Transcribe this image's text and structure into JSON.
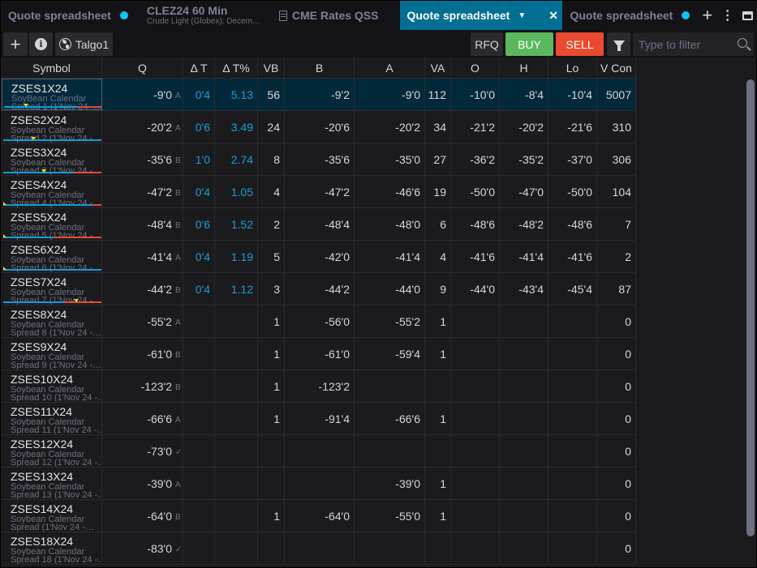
{
  "tabs": [
    {
      "label": "Quote spreadsheet",
      "dot": true,
      "active": false
    },
    {
      "label": "CLEZ24 60 Min",
      "sublabel": "Crude Light (Globex): Decem…",
      "active": false
    },
    {
      "label": "CME Rates QSS",
      "icon": "book-icon",
      "active": false
    },
    {
      "label": "Quote spreadsheet",
      "dot": true,
      "active": true
    },
    {
      "label": "Quote spreadsheet",
      "dot": true,
      "active": false
    }
  ],
  "tabbar_icons": [
    "plus-icon",
    "more-vertical-icon",
    "maximize-icon"
  ],
  "toolbar": {
    "add_label": "+",
    "info_icon": "i",
    "account_label": "Talgo1",
    "rfq_label": "RFQ",
    "buy_label": "BUY",
    "sell_label": "SELL",
    "filter_placeholder": "Type to filter",
    "filter_value": ""
  },
  "colors": {
    "accent": "#006f93",
    "buy": "#5cb85c",
    "sell": "#ea4a2f",
    "positive_change": "#1a9dd8",
    "dot": "#10c4f4",
    "selected_row": "#01293a"
  },
  "grid": {
    "columns": [
      "Symbol",
      "Q",
      "Δ T",
      "Δ T%",
      "VB",
      "B",
      "A",
      "VA",
      "O",
      "H",
      "Lo",
      "V Con"
    ],
    "rows": [
      {
        "symbol": "ZSES1X24",
        "desc1": "SoyBean Calendar",
        "desc2": "Spread 1 (1'Nov 24 -…",
        "q": "-9'0",
        "q_tag": "A",
        "dt": "0'4",
        "dtp": "5.13",
        "vb": "56",
        "b": "-9'2",
        "a": "-9'0",
        "va": "112",
        "o": "-10'0",
        "h": "-8'4",
        "lo": "-10'4",
        "vcon": "5007",
        "bar_blue_pct": 76,
        "marker_pct": 24
      },
      {
        "symbol": "ZSES2X24",
        "desc1": "Soybean Calendar",
        "desc2": "Spread 2 (1'Nov 24 -…",
        "q": "-20'2",
        "q_tag": "A",
        "dt": "0'6",
        "dtp": "3.49",
        "vb": "24",
        "b": "-20'6",
        "a": "-20'2",
        "va": "34",
        "o": "-21'2",
        "h": "-20'2",
        "lo": "-21'6",
        "vcon": "310",
        "bar_blue_pct": 100,
        "marker_pct": 32
      },
      {
        "symbol": "ZSES3X24",
        "desc1": "Soybean Calendar",
        "desc2": "Spread 3 (1'Nov 24 -…",
        "q": "-35'6",
        "q_tag": "B",
        "dt": "1'0",
        "dtp": "2.74",
        "vb": "8",
        "b": "-35'6",
        "a": "-35'0",
        "va": "27",
        "o": "-36'2",
        "h": "-35'2",
        "lo": "-37'0",
        "vcon": "306",
        "bar_blue_pct": 72,
        "marker_pct": 42
      },
      {
        "symbol": "ZSES4X24",
        "desc1": "Soybean Calendar",
        "desc2": "Spread 4 (1'Nov 24 -…",
        "q": "-47'2",
        "q_tag": "B",
        "dt": "0'4",
        "dtp": "1.05",
        "vb": "4",
        "b": "-47'2",
        "a": "-46'6",
        "va": "19",
        "o": "-50'0",
        "h": "-47'0",
        "lo": "-50'0",
        "vcon": "104",
        "bar_blue_pct": 91,
        "marker_pct": 0
      },
      {
        "symbol": "ZSES5X24",
        "desc1": "Soybean Calendar",
        "desc2": "Spread 5 (1'Nov 24 -…",
        "q": "-48'4",
        "q_tag": "B",
        "dt": "0'6",
        "dtp": "1.52",
        "vb": "2",
        "b": "-48'4",
        "a": "-48'0",
        "va": "6",
        "o": "-48'6",
        "h": "-48'2",
        "lo": "-48'6",
        "vcon": "7",
        "bar_blue_pct": 51,
        "marker_pct": 0
      },
      {
        "symbol": "ZSES6X24",
        "desc1": "Soybean Calendar",
        "desc2": "Spread 6 (1'Nov 24 -…",
        "q": "-41'4",
        "q_tag": "A",
        "dt": "0'4",
        "dtp": "1.19",
        "vb": "5",
        "b": "-42'0",
        "a": "-41'4",
        "va": "4",
        "o": "-41'6",
        "h": "-41'4",
        "lo": "-41'6",
        "vcon": "2",
        "bar_blue_pct": 100,
        "marker_pct": 0
      },
      {
        "symbol": "ZSES7X24",
        "desc1": "Soybean Calendar",
        "desc2": "Spread 7 (1'Nov 24 -…",
        "q": "-44'2",
        "q_tag": "B",
        "dt": "0'4",
        "dtp": "1.12",
        "vb": "3",
        "b": "-44'2",
        "a": "-44'0",
        "va": "9",
        "o": "-44'0",
        "h": "-43'4",
        "lo": "-45'4",
        "vcon": "87",
        "bar_blue_pct": 62,
        "marker_pct": 75
      },
      {
        "symbol": "ZSES8X24",
        "desc1": "Soybean Calendar",
        "desc2": "Spread 8 (1'Nov 24 -…",
        "q": "-55'2",
        "q_tag": "A",
        "dt": "",
        "dtp": "",
        "vb": "1",
        "b": "-56'0",
        "a": "-55'2",
        "va": "1",
        "o": "",
        "h": "",
        "lo": "",
        "vcon": "0"
      },
      {
        "symbol": "ZSES9X24",
        "desc1": "Soybean Calendar",
        "desc2": "Spread 9 (1'Nov 24 -…",
        "q": "-61'0",
        "q_tag": "B",
        "dt": "",
        "dtp": "",
        "vb": "1",
        "b": "-61'0",
        "a": "-59'4",
        "va": "1",
        "o": "",
        "h": "",
        "lo": "",
        "vcon": "0"
      },
      {
        "symbol": "ZSES10X24",
        "desc1": "Soybean Calendar",
        "desc2": "Spread 10 (1'Nov 24 -…",
        "q": "-123'2",
        "q_tag": "B",
        "dt": "",
        "dtp": "",
        "vb": "1",
        "b": "-123'2",
        "a": "",
        "va": "",
        "o": "",
        "h": "",
        "lo": "",
        "vcon": "0"
      },
      {
        "symbol": "ZSES11X24",
        "desc1": "Soybean Calendar",
        "desc2": "Spread 11 (1'Nov 24 -…",
        "q": "-66'6",
        "q_tag": "A",
        "dt": "",
        "dtp": "",
        "vb": "1",
        "b": "-91'4",
        "a": "-66'6",
        "va": "1",
        "o": "",
        "h": "",
        "lo": "",
        "vcon": "0"
      },
      {
        "symbol": "ZSES12X24",
        "desc1": "Soybean Calendar",
        "desc2": "Spread 12 (1'Nov 24 -…",
        "q": "-73'0",
        "q_tag": "✓",
        "dt": "",
        "dtp": "",
        "vb": "",
        "b": "",
        "a": "",
        "va": "",
        "o": "",
        "h": "",
        "lo": "",
        "vcon": "0"
      },
      {
        "symbol": "ZSES13X24",
        "desc1": "Soybean Calendar",
        "desc2": "Spread 13 (1'Nov 24 -…",
        "q": "-39'0",
        "q_tag": "A",
        "dt": "",
        "dtp": "",
        "vb": "",
        "b": "",
        "a": "-39'0",
        "va": "1",
        "o": "",
        "h": "",
        "lo": "",
        "vcon": "0"
      },
      {
        "symbol": "ZSES14X24",
        "desc1": "Soybean Calendar",
        "desc2": "Spread (1'Nov 24 -…",
        "q": "-64'0",
        "q_tag": "B",
        "dt": "",
        "dtp": "",
        "vb": "1",
        "b": "-64'0",
        "a": "-55'0",
        "va": "1",
        "o": "",
        "h": "",
        "lo": "",
        "vcon": "0"
      },
      {
        "symbol": "ZSES18X24",
        "desc1": "Soybean Calendar",
        "desc2": "Spread 18 (1'Nov 24 -…",
        "q": "-83'0",
        "q_tag": "✓",
        "dt": "",
        "dtp": "",
        "vb": "",
        "b": "",
        "a": "",
        "va": "",
        "o": "",
        "h": "",
        "lo": "",
        "vcon": "0"
      }
    ],
    "selected_row": 0
  }
}
